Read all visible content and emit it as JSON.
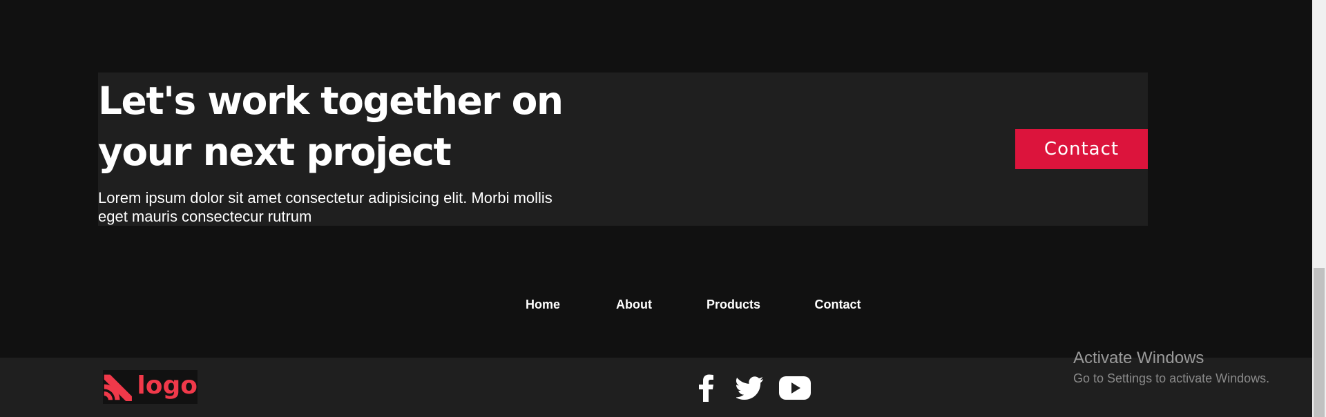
{
  "cta": {
    "title": "Let's work together on your next project",
    "description": "Lorem ipsum dolor sit amet consectetur adipisicing elit. Morbi mollis eget mauris consectecur rutrum",
    "button_label": "Contact"
  },
  "footer_nav": {
    "items": [
      {
        "label": "Home"
      },
      {
        "label": "About"
      },
      {
        "label": "Products"
      },
      {
        "label": "Contact"
      }
    ]
  },
  "brand": {
    "logo_text": "logo",
    "logo_color": "#f0394a"
  },
  "social": {
    "icons": [
      "facebook-icon",
      "twitter-icon",
      "youtube-icon"
    ]
  },
  "watermark": {
    "title": "Activate Windows",
    "subtitle": "Go to Settings to activate Windows."
  },
  "colors": {
    "background": "#111111",
    "panel": "#1f1f1f",
    "accent": "#dc143c",
    "text": "#ffffff"
  }
}
